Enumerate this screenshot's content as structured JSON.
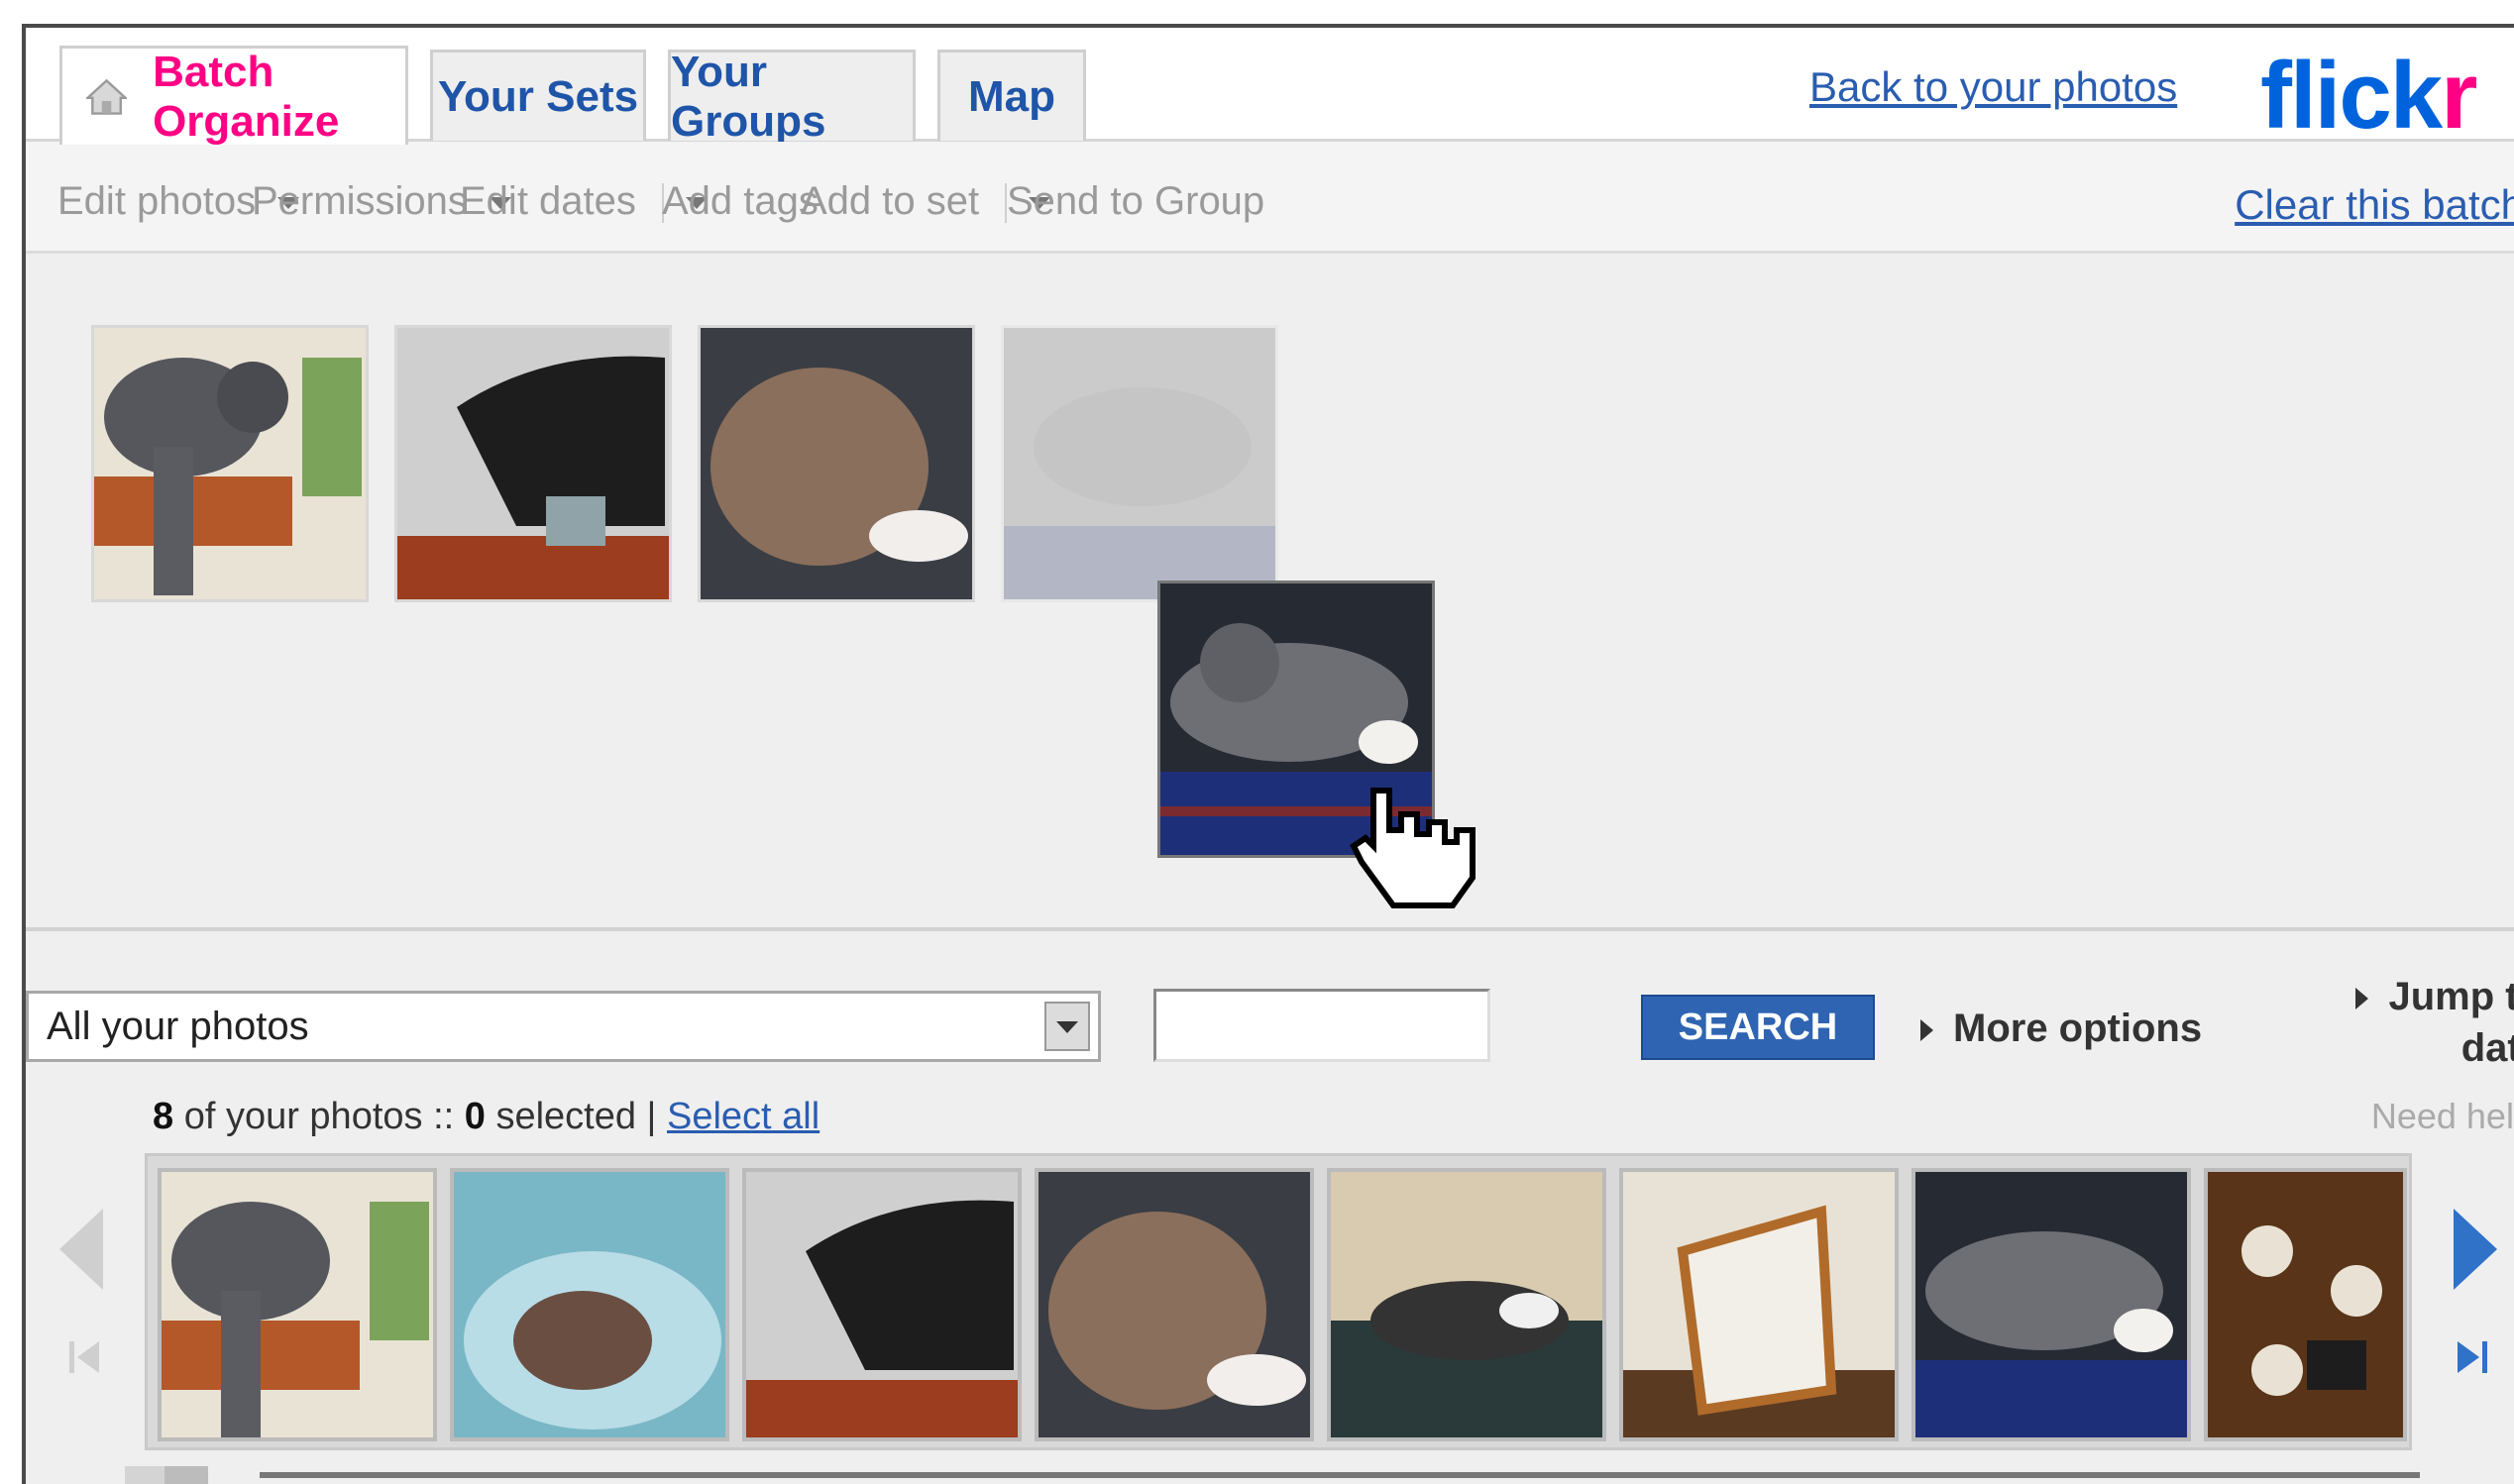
{
  "tabs": [
    {
      "label": "Batch Organize",
      "active": true
    },
    {
      "label": "Your Sets",
      "active": false
    },
    {
      "label": "Your Groups",
      "active": false
    },
    {
      "label": "Map",
      "active": false
    }
  ],
  "header": {
    "back_link": "Back to your photos",
    "logo_main": "flick",
    "logo_r": "r"
  },
  "toolbar": {
    "edit_photos": "Edit photos",
    "permissions": "Permissions",
    "edit_dates": "Edit dates",
    "add_tags": "Add tags",
    "add_to_set": "Add to set",
    "send_to_group": "Send to Group",
    "clear_batch": "Clear this batch"
  },
  "controls": {
    "filter_selected": "All your photos",
    "search_value": "",
    "search_button": "SEARCH",
    "more_options": "More options",
    "jump_line1": "Jump to",
    "jump_line2": "date",
    "count_number": "8",
    "count_text": " of your photos :: ",
    "selected_number": "0",
    "selected_text": " selected | ",
    "select_all": "Select all",
    "need_help": "Need help?"
  },
  "colors": {
    "tab_active": "#ff0084",
    "tab_text": "#1f55a8",
    "search_button": "#2f64b2",
    "link": "#2a5db0"
  }
}
